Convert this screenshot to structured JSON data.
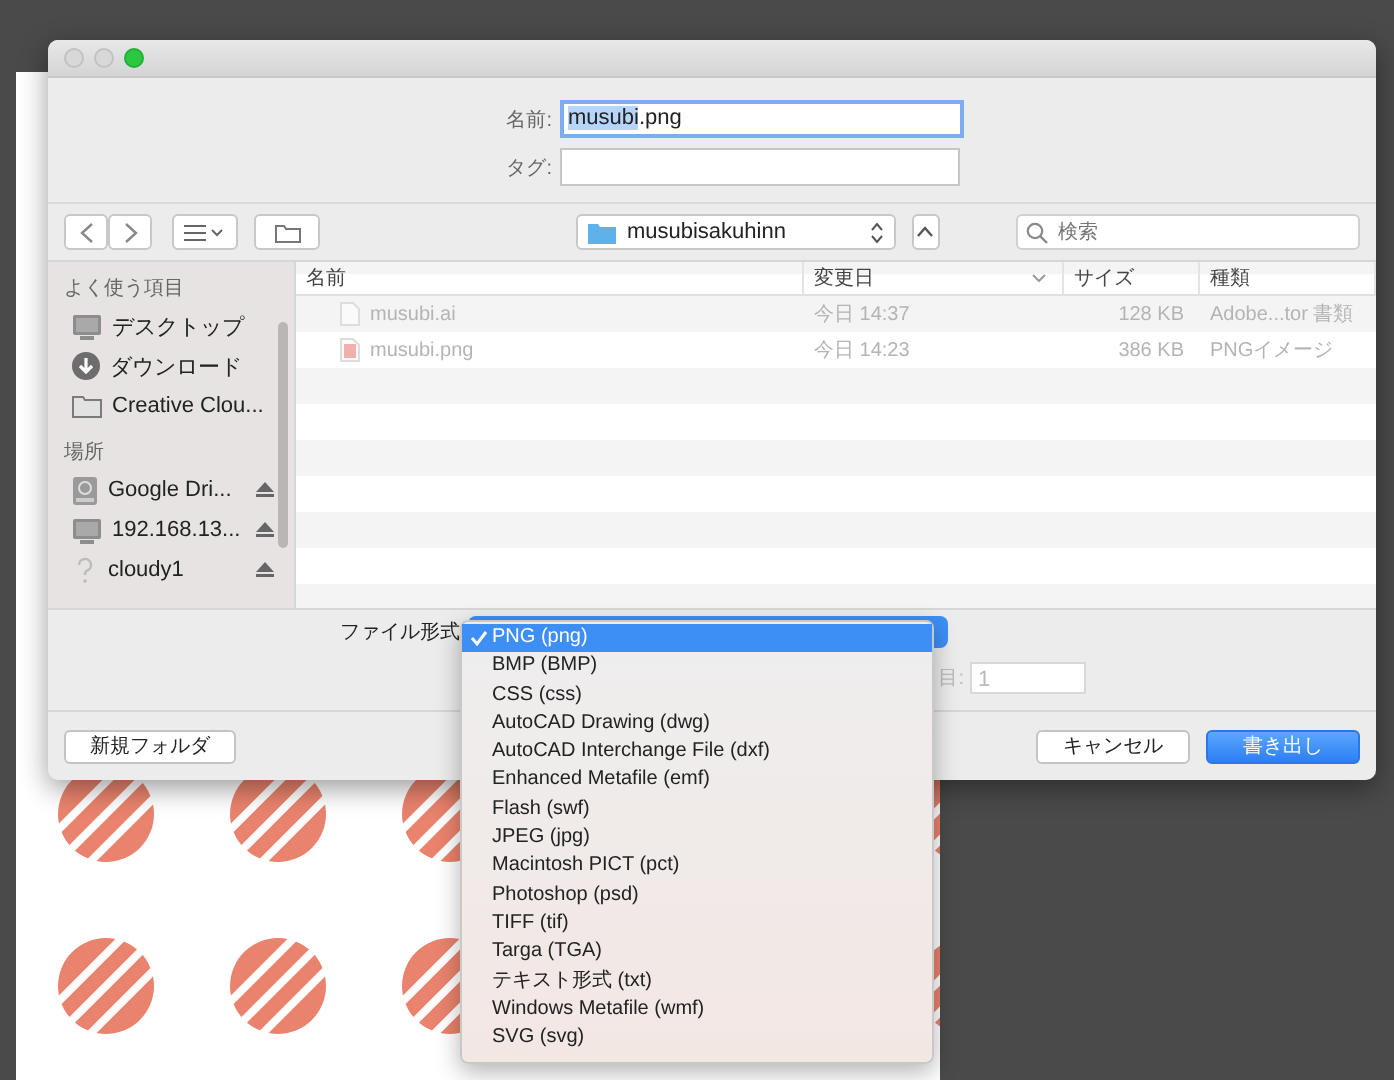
{
  "name_field": {
    "label": "名前:",
    "value_parts": [
      {
        "text": "musubi",
        "selected": true
      },
      {
        "text": ".png",
        "selected": false
      }
    ]
  },
  "tag_field": {
    "label": "タグ:"
  },
  "toolbar": {
    "location": "musubisakuhinn",
    "search": {
      "placeholder": "検索"
    }
  },
  "sidebar": {
    "sections": [
      {
        "heading": "よく使う項目",
        "items": [
          {
            "label": "デスクトップ",
            "kind": "display",
            "eject": false
          },
          {
            "label": "ダウンロード",
            "kind": "download",
            "eject": false
          },
          {
            "label": "Creative Clou...",
            "kind": "folder",
            "eject": false
          }
        ]
      },
      {
        "heading": "場所",
        "items": [
          {
            "label": "Google Dri...",
            "kind": "drive",
            "eject": true
          },
          {
            "label": "192.168.13...",
            "kind": "display",
            "eject": true
          },
          {
            "label": "cloudy1",
            "kind": "unknown",
            "eject": true
          }
        ]
      }
    ]
  },
  "table": {
    "columns": [
      {
        "label": "名前",
        "sorted": false
      },
      {
        "label": "変更日",
        "sorted": true
      },
      {
        "label": "サイズ",
        "sorted": false
      },
      {
        "label": "種類",
        "sorted": false
      }
    ],
    "rows": [
      {
        "name": "musubi.ai",
        "date": "今日 14:37",
        "size": "128 KB",
        "type": "Adobe...tor 書類",
        "kind": "ai",
        "disabled": true
      },
      {
        "name": "musubi.png",
        "date": "今日 14:23",
        "size": "386 KB",
        "type": "PNGイメージ",
        "kind": "png",
        "disabled": true
      }
    ]
  },
  "format": {
    "label": "ファイル形式",
    "options": [
      {
        "label": "PNG (png)",
        "selected": true
      },
      {
        "label": "BMP (BMP)",
        "selected": false
      },
      {
        "label": "CSS (css)",
        "selected": false
      },
      {
        "label": "AutoCAD Drawing (dwg)",
        "selected": false
      },
      {
        "label": "AutoCAD Interchange File (dxf)",
        "selected": false
      },
      {
        "label": "Enhanced Metafile (emf)",
        "selected": false
      },
      {
        "label": "Flash (swf)",
        "selected": false
      },
      {
        "label": "JPEG (jpg)",
        "selected": false
      },
      {
        "label": "Macintosh PICT (pct)",
        "selected": false
      },
      {
        "label": "Photoshop (psd)",
        "selected": false
      },
      {
        "label": "TIFF (tif)",
        "selected": false
      },
      {
        "label": "Targa (TGA)",
        "selected": false
      },
      {
        "label": "テキスト形式 (txt)",
        "selected": false
      },
      {
        "label": "Windows Metafile (wmf)",
        "selected": false
      },
      {
        "label": "SVG (svg)",
        "selected": false
      }
    ]
  },
  "range_field": {
    "label": "目:",
    "value": "1"
  },
  "buttons": [
    {
      "label": "新規フォルダ",
      "kind": "plain"
    },
    {
      "label": "キャンセル",
      "kind": "plain"
    },
    {
      "label": "書き出し",
      "kind": "default"
    }
  ]
}
